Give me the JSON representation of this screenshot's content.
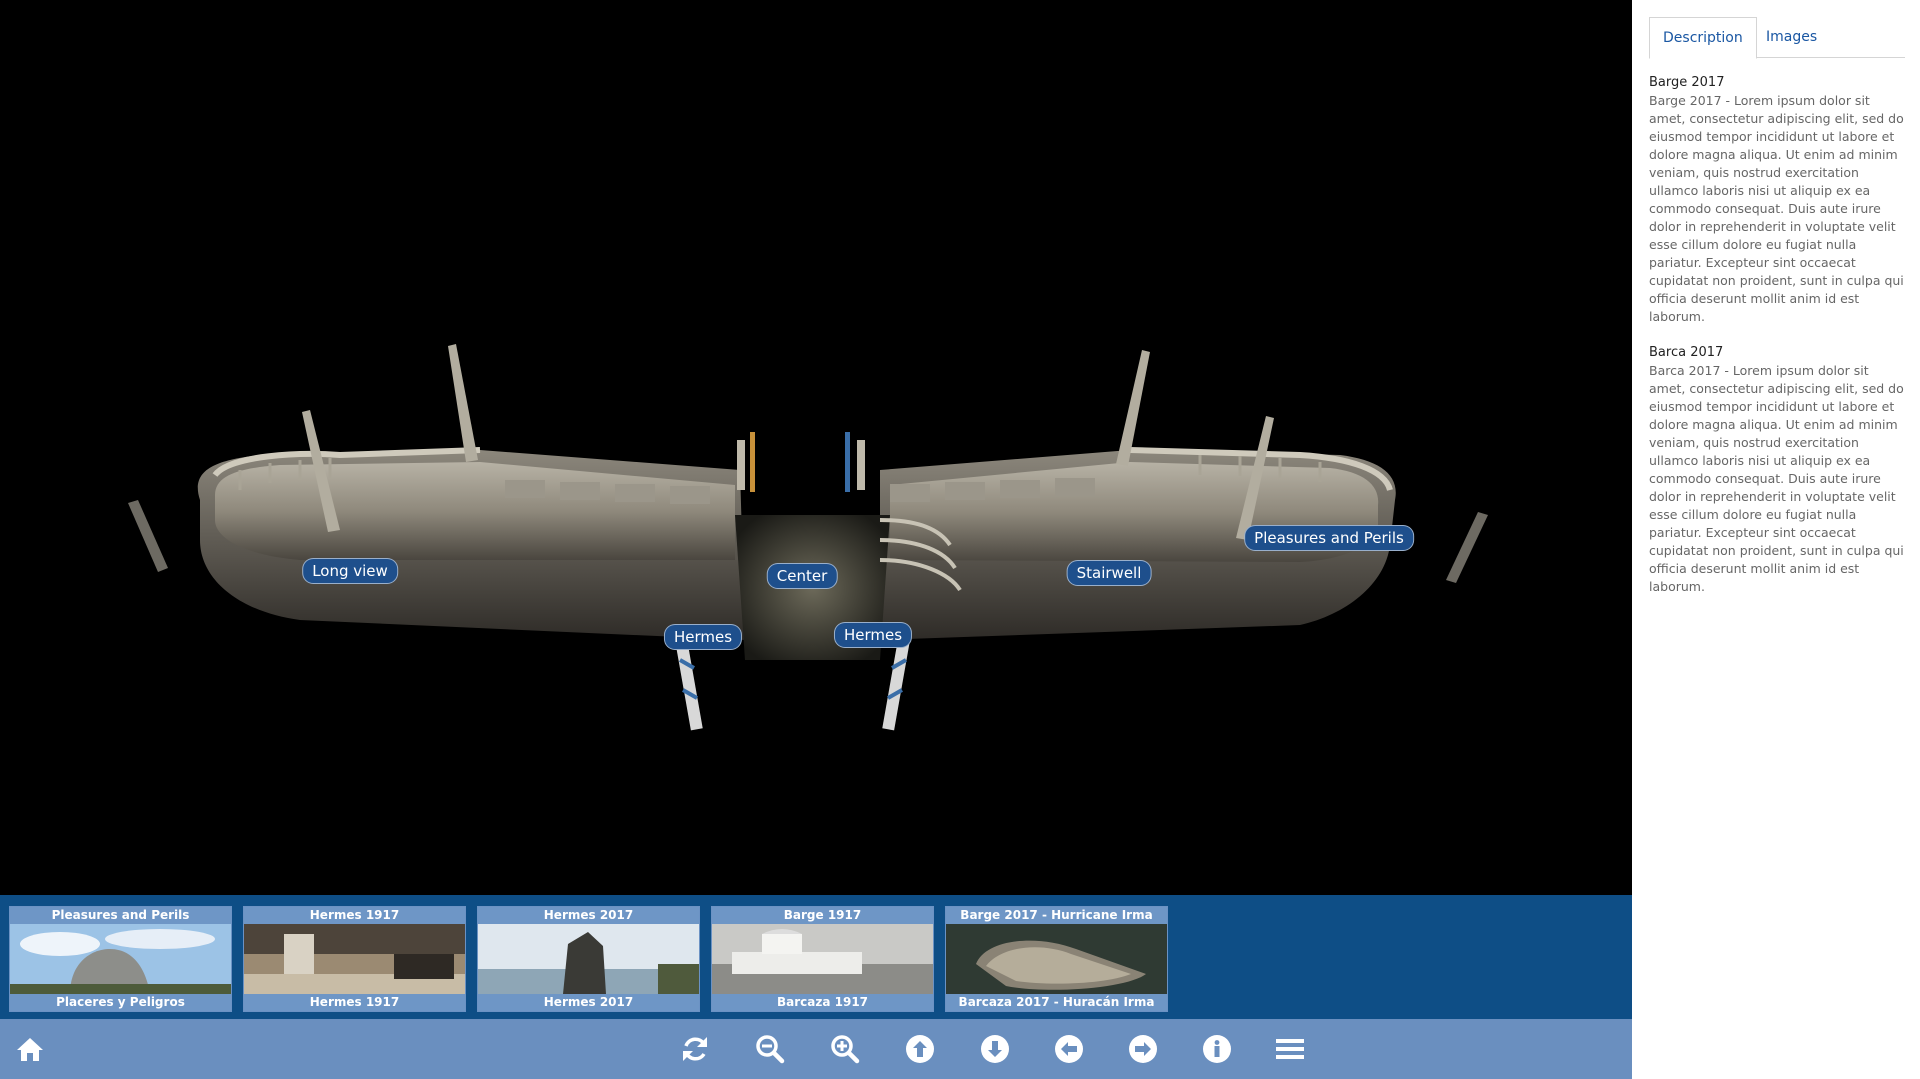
{
  "viewer": {
    "hotspots": [
      {
        "id": "long-view",
        "label": "Long view"
      },
      {
        "id": "center",
        "label": "Center"
      },
      {
        "id": "hermes-left",
        "label": "Hermes"
      },
      {
        "id": "hermes-right",
        "label": "Hermes"
      },
      {
        "id": "stairwell",
        "label": "Stairwell"
      },
      {
        "id": "pleasures-perils",
        "label": "Pleasures and Perils"
      }
    ]
  },
  "thumbnails": [
    {
      "title": "Pleasures and Perils",
      "caption": "Placeres y Peligros"
    },
    {
      "title": "Hermes 1917",
      "caption": "Hermes 1917"
    },
    {
      "title": "Hermes 2017",
      "caption": "Hermes 2017"
    },
    {
      "title": "Barge 1917",
      "caption": "Barcaza 1917"
    },
    {
      "title": "Barge 2017 - Hurricane Irma",
      "caption": "Barcaza 2017 - Huracán Irma"
    }
  ],
  "toolbar": {
    "left_icons": [
      "home-icon"
    ],
    "center_icons": [
      "refresh-icon",
      "zoom-out-icon",
      "zoom-in-icon",
      "arrow-up-icon",
      "arrow-down-icon",
      "arrow-left-icon",
      "arrow-right-icon",
      "info-icon",
      "menu-icon"
    ]
  },
  "panel": {
    "tabs": [
      {
        "label": "Description",
        "active": true
      },
      {
        "label": "Images",
        "active": false
      }
    ],
    "sections": [
      {
        "title": "Barge 2017",
        "body": "Barge 2017 - Lorem ipsum dolor sit amet, consectetur adipiscing elit, sed do eiusmod tempor incididunt ut labore et dolore magna aliqua. Ut enim ad minim veniam, quis nostrud exercitation ullamco laboris nisi ut aliquip ex ea commodo consequat. Duis aute irure dolor in reprehenderit in voluptate velit esse cillum dolore eu fugiat nulla pariatur. Excepteur sint occaecat cupidatat non proident, sunt in culpa qui officia deserunt mollit anim id est laborum."
      },
      {
        "title": "Barca 2017",
        "body": "Barca 2017 - Lorem ipsum dolor sit amet, consectetur adipiscing elit, sed do eiusmod tempor incididunt ut labore et dolore magna aliqua. Ut enim ad minim veniam, quis nostrud exercitation ullamco laboris nisi ut aliquip ex ea commodo consequat. Duis aute irure dolor in reprehenderit in voluptate velit esse cillum dolore eu fugiat nulla pariatur. Excepteur sint occaecat cupidatat non proident, sunt in culpa qui officia deserunt mollit anim id est laborum."
      }
    ]
  },
  "colors": {
    "strip": "#0e4e86",
    "toolbar": "#6a8fbf",
    "hotspot": "#1e4f8c",
    "tab_text": "#1a57a3"
  }
}
